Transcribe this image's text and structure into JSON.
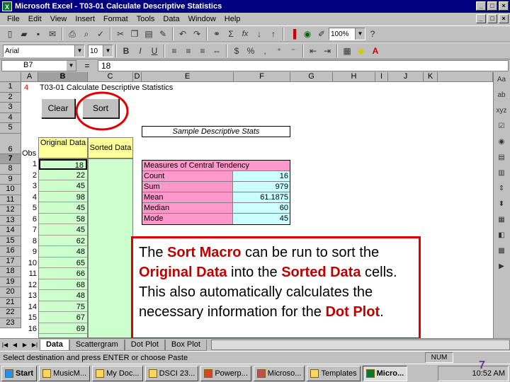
{
  "window": {
    "title": "Microsoft Excel - T03-01 Calculate Descriptive Statistics"
  },
  "menu": [
    "File",
    "Edit",
    "View",
    "Insert",
    "Format",
    "Tools",
    "Data",
    "Window",
    "Help"
  ],
  "toolbar": {
    "zoom": "100%",
    "font": "Arial",
    "font_size": "10",
    "sigma": "Σ",
    "fx": "fx"
  },
  "formula_bar": {
    "cell_ref": "B7",
    "equals": "=",
    "value": "18"
  },
  "columns": [
    "A",
    "B",
    "C",
    "D",
    "E",
    "F",
    "G",
    "H",
    "I",
    "J",
    "K"
  ],
  "rows": [
    "1",
    "2",
    "3",
    "4",
    "5",
    "6",
    "7",
    "8",
    "9",
    "10",
    "11",
    "12",
    "13",
    "14",
    "15",
    "16",
    "17",
    "18",
    "19",
    "20",
    "21",
    "22",
    "23"
  ],
  "sheet": {
    "a1": "4",
    "title": "T03-01 Calculate Descriptive Statistics",
    "clear_btn": "Clear",
    "sort_btn": "Sort",
    "sample_header": "Sample Descriptive Stats",
    "obs_header": "Obs",
    "original_header": "Original Data",
    "sorted_header": "Sorted Data",
    "obs": [
      "1",
      "2",
      "3",
      "4",
      "5",
      "6",
      "7",
      "8",
      "9",
      "10",
      "11",
      "12",
      "13",
      "14",
      "15",
      "16"
    ],
    "original": [
      "18",
      "22",
      "45",
      "98",
      "45",
      "58",
      "45",
      "62",
      "48",
      "65",
      "66",
      "68",
      "48",
      "75",
      "67",
      "69"
    ],
    "central_tendency": {
      "header": "Measures of Central Tendency",
      "rows": [
        {
          "label": "Count",
          "value": "16"
        },
        {
          "label": "Sum",
          "value": "979"
        },
        {
          "label": "Mean",
          "value": "61.1875"
        },
        {
          "label": "Median",
          "value": "60"
        },
        {
          "label": "Mode",
          "value": "45"
        }
      ]
    }
  },
  "callout": {
    "p1": "The ",
    "b1": "Sort Macro",
    "p2": " can be run to sort the ",
    "b2": "Original Data",
    "p3": " into the ",
    "b3": "Sorted Data",
    "p4": " cells.  This also automatically calculates the necessary information for the ",
    "b4": "Dot Plot",
    "p5": "."
  },
  "tabs": [
    "Data",
    "Scattergram",
    "Dot Plot",
    "Box Plot"
  ],
  "status": {
    "message": "Select destination and press ENTER or choose Paste",
    "num": "NUM"
  },
  "taskbar": {
    "start": "Start",
    "items": [
      "MusicM...",
      "My Doc...",
      "DSCI 23...",
      "Powerp...",
      "Microso...",
      "Templates",
      "Micro..."
    ],
    "clock": "10:52 AM"
  },
  "slide_number": "7",
  "colors": {
    "titlebar": "#000080",
    "data_green": "#ccffcc",
    "stat_pink": "#ff99cc",
    "stat_cyan": "#ccffff",
    "callout_border": "#e00000"
  }
}
